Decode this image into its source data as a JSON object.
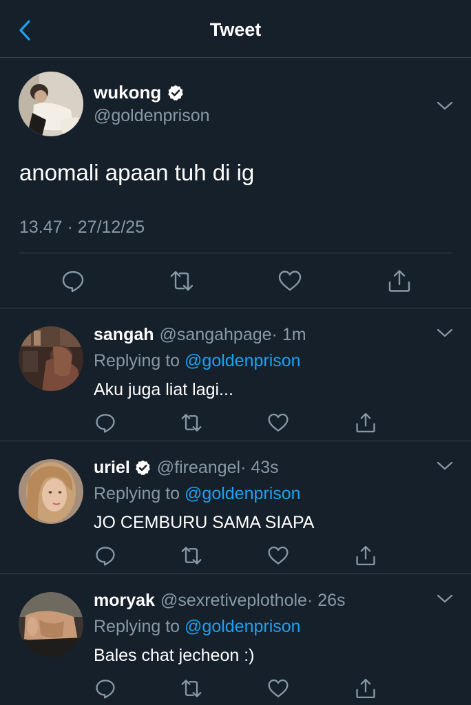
{
  "header": {
    "title": "Tweet",
    "accent_color": "#1da1f2"
  },
  "main_tweet": {
    "name": "wukong",
    "verified": true,
    "handle": "@goldenprison",
    "text": "anomali apaan tuh di ig",
    "timestamp": "13.47 · 27/12/25",
    "actions": [
      "reply-icon",
      "retweet-icon",
      "like-icon",
      "share-icon"
    ]
  },
  "replies": [
    {
      "name": "sangah",
      "verified": false,
      "handle": "@sangahpage",
      "time": " · 1m",
      "replying_prefix": "Replying to ",
      "replying_to": "@goldenprison",
      "text": "Aku juga liat lagi..."
    },
    {
      "name": "uriel",
      "verified": true,
      "handle": "@fireangel",
      "time": " · 43s",
      "replying_prefix": "Replying to ",
      "replying_to": "@goldenprison",
      "text": "JO CEMBURU SAMA SIAPA"
    },
    {
      "name": "moryak",
      "verified": false,
      "handle": "@sexretiveplothole",
      "time": " · 26s",
      "replying_prefix": "Replying to ",
      "replying_to": "@goldenprison",
      "text": "Bales chat jecheon :)"
    }
  ],
  "colors": {
    "background": "#15202b",
    "secondary_text": "#8899a6",
    "divider": "#38444d",
    "mention": "#1da1f2"
  }
}
